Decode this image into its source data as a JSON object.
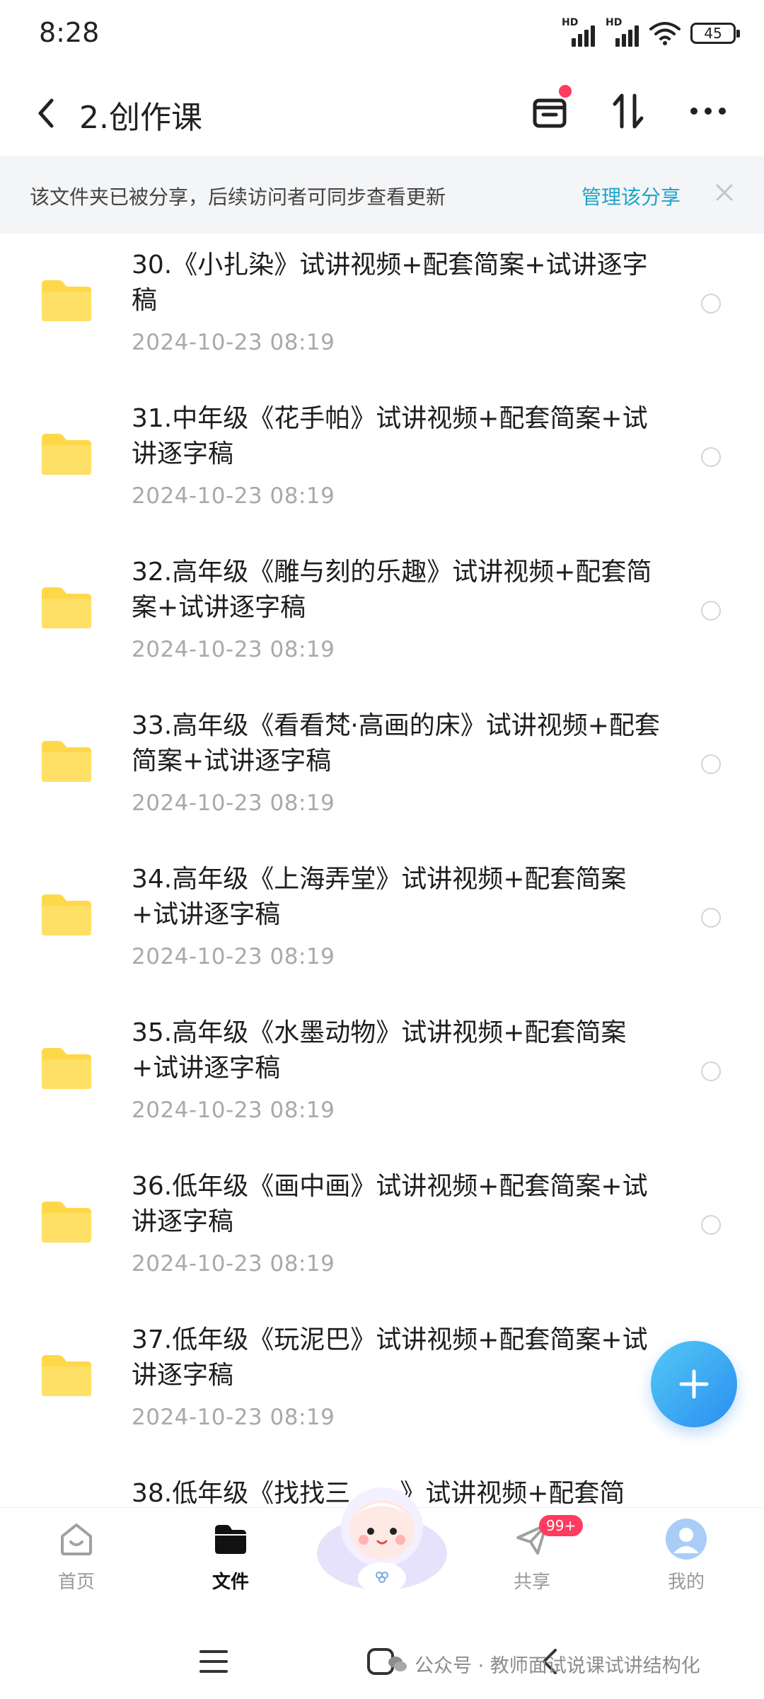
{
  "status_bar": {
    "time": "8:28",
    "signal_1_label": "HD",
    "signal_2_label": "HD",
    "battery": "45"
  },
  "header": {
    "title": "2.创作课",
    "icons": [
      "back-chevron-icon",
      "inbox-tray-icon",
      "sort-arrows-icon",
      "more-dots-icon"
    ]
  },
  "banner": {
    "text": "该文件夹已被分享，后续访问者可同步查看更新",
    "link": "管理该分享"
  },
  "files": [
    {
      "name": "30.《小扎染》试讲视频+配套简案+试讲逐字稿",
      "date": "2024-10-23  08:19"
    },
    {
      "name": "31.中年级《花手帕》试讲视频+配套简案+试讲逐字稿",
      "date": "2024-10-23  08:19"
    },
    {
      "name": "32.高年级《雕与刻的乐趣》试讲视频+配套简案+试讲逐字稿",
      "date": "2024-10-23  08:19"
    },
    {
      "name": "33.高年级《看看梵·高画的床》试讲视频+配套简案+试讲逐字稿",
      "date": "2024-10-23  08:19"
    },
    {
      "name": "34.高年级《上海弄堂》试讲视频+配套简案+试讲逐字稿",
      "date": "2024-10-23  08:19"
    },
    {
      "name": "35.高年级《水墨动物》试讲视频+配套简案+试讲逐字稿",
      "date": "2024-10-23  08:19"
    },
    {
      "name": "36.低年级《画中画》试讲视频+配套简案+试讲逐字稿",
      "date": "2024-10-23  08:19"
    },
    {
      "name": "37.低年级《玩泥巴》试讲视频+配套简案+试讲逐字稿",
      "date": "2024-10-23  08:19"
    },
    {
      "name": "38.低年级《找找三",
      "name_tail": "》试讲视频+配套简",
      "date": ""
    }
  ],
  "bottom_nav": {
    "home": "首页",
    "files": "文件",
    "share": "共享",
    "share_badge": "99+",
    "me": "我的"
  },
  "watermark": "公众号 · 教师面试说课试讲结构化",
  "colors": {
    "accent": "#1ea4c8",
    "folder": "#ffd84a",
    "fab_start": "#53c8f5",
    "fab_end": "#2a8ff0",
    "badge": "#ff3b5f"
  }
}
